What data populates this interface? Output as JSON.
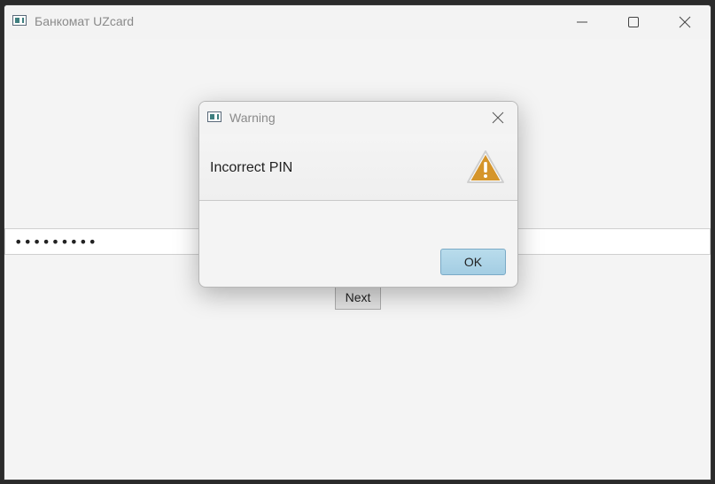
{
  "window": {
    "title": "Банкомат UZcard",
    "controls": {
      "minimize": "minimize-icon",
      "maximize": "maximize-icon",
      "close": "close-icon"
    }
  },
  "pin": {
    "value": "•••••••••",
    "type": "password"
  },
  "buttons": {
    "next_label": "Next"
  },
  "dialog": {
    "title": "Warning",
    "header_text": "Incorrect PIN",
    "ok_label": "OK",
    "icon": "warning-icon"
  },
  "colors": {
    "ok_button": "#a9d3e8",
    "warning_triangle": "#d5952b"
  }
}
